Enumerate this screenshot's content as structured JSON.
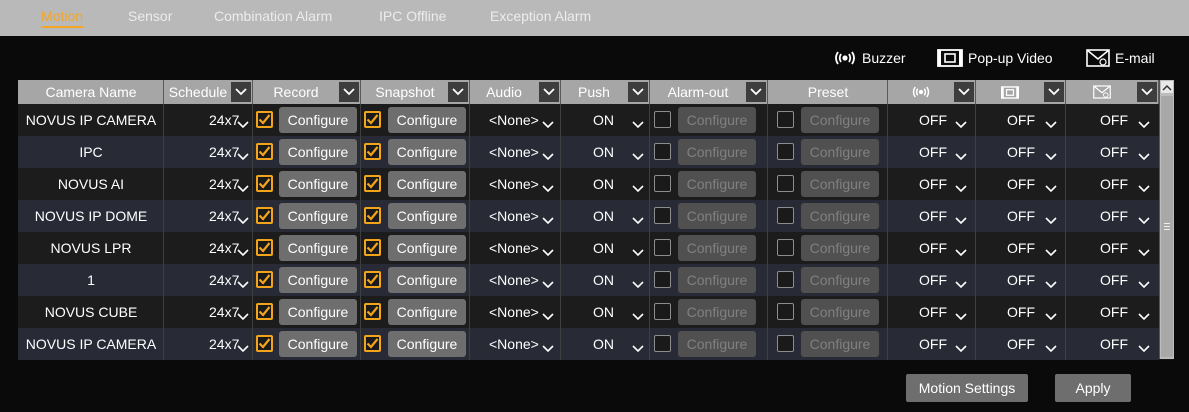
{
  "tabs": [
    {
      "label": "Motion",
      "active": true
    },
    {
      "label": "Sensor",
      "active": false
    },
    {
      "label": "Combination Alarm",
      "active": false
    },
    {
      "label": "IPC Offline",
      "active": false
    },
    {
      "label": "Exception Alarm",
      "active": false
    }
  ],
  "notifications": {
    "buzzer_label": "Buzzer",
    "popup_label": "Pop-up Video",
    "email_label": "E-mail"
  },
  "table": {
    "headers": {
      "camera_name": "Camera Name",
      "schedule": "Schedule",
      "record": "Record",
      "snapshot": "Snapshot",
      "audio": "Audio",
      "push": "Push",
      "alarm_out": "Alarm-out",
      "preset": "Preset"
    },
    "header_icons": [
      "buzzer-icon",
      "popup-video-icon",
      "email-icon"
    ],
    "configure_label": "Configure",
    "rows": [
      {
        "name": "NOVUS IP CAMERA",
        "schedule": "24x7",
        "record": true,
        "snapshot": true,
        "audio": "<None>",
        "push": "ON",
        "alarm_out": false,
        "preset": false,
        "buzzer": "OFF",
        "popup": "OFF",
        "email": "OFF"
      },
      {
        "name": "IPC",
        "schedule": "24x7",
        "record": true,
        "snapshot": true,
        "audio": "<None>",
        "push": "ON",
        "alarm_out": false,
        "preset": false,
        "buzzer": "OFF",
        "popup": "OFF",
        "email": "OFF"
      },
      {
        "name": "NOVUS AI",
        "schedule": "24x7",
        "record": true,
        "snapshot": true,
        "audio": "<None>",
        "push": "ON",
        "alarm_out": false,
        "preset": false,
        "buzzer": "OFF",
        "popup": "OFF",
        "email": "OFF"
      },
      {
        "name": "NOVUS IP DOME",
        "schedule": "24x7",
        "record": true,
        "snapshot": true,
        "audio": "<None>",
        "push": "ON",
        "alarm_out": false,
        "preset": false,
        "buzzer": "OFF",
        "popup": "OFF",
        "email": "OFF"
      },
      {
        "name": "NOVUS LPR",
        "schedule": "24x7",
        "record": true,
        "snapshot": true,
        "audio": "<None>",
        "push": "ON",
        "alarm_out": false,
        "preset": false,
        "buzzer": "OFF",
        "popup": "OFF",
        "email": "OFF"
      },
      {
        "name": "1",
        "schedule": "24x7",
        "record": true,
        "snapshot": true,
        "audio": "<None>",
        "push": "ON",
        "alarm_out": false,
        "preset": false,
        "buzzer": "OFF",
        "popup": "OFF",
        "email": "OFF"
      },
      {
        "name": "NOVUS CUBE",
        "schedule": "24x7",
        "record": true,
        "snapshot": true,
        "audio": "<None>",
        "push": "ON",
        "alarm_out": false,
        "preset": false,
        "buzzer": "OFF",
        "popup": "OFF",
        "email": "OFF"
      },
      {
        "name": "NOVUS IP CAMERA",
        "schedule": "24x7",
        "record": true,
        "snapshot": true,
        "audio": "<None>",
        "push": "ON",
        "alarm_out": false,
        "preset": false,
        "buzzer": "OFF",
        "popup": "OFF",
        "email": "OFF"
      }
    ]
  },
  "footer": {
    "motion_settings_label": "Motion Settings",
    "apply_label": "Apply"
  },
  "colors": {
    "accent": "#f5a623",
    "checkbox_checked": "#f2a51a",
    "header_bg": "#a6a6a6",
    "row_odd": "#1c1c1c",
    "row_even": "#282a35"
  }
}
